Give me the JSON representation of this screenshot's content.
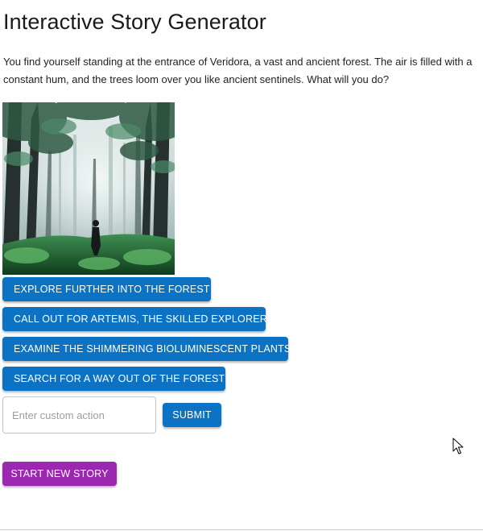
{
  "page": {
    "title": "Interactive Story Generator",
    "story_text": "You find yourself standing at the entrance of Veridora, a vast and ancient forest. The air is filled with a constant hum, and the trees loom over you like ancient sentinels. What will you do?"
  },
  "scene_image": {
    "icon": "forest-scene-image"
  },
  "choices": [
    {
      "label": "Explore further into the forest"
    },
    {
      "label": "Call out for Artemis, the skilled explorer"
    },
    {
      "label": "Examine the shimmering bioluminescent plants"
    },
    {
      "label": "Search for a way out of the forest"
    }
  ],
  "custom_action": {
    "placeholder": "Enter custom action",
    "value": "",
    "submit_label": "Submit"
  },
  "new_story": {
    "label": "Start New Story"
  },
  "colors": {
    "primary": "#0b72c4",
    "secondary": "#9c27b0"
  }
}
